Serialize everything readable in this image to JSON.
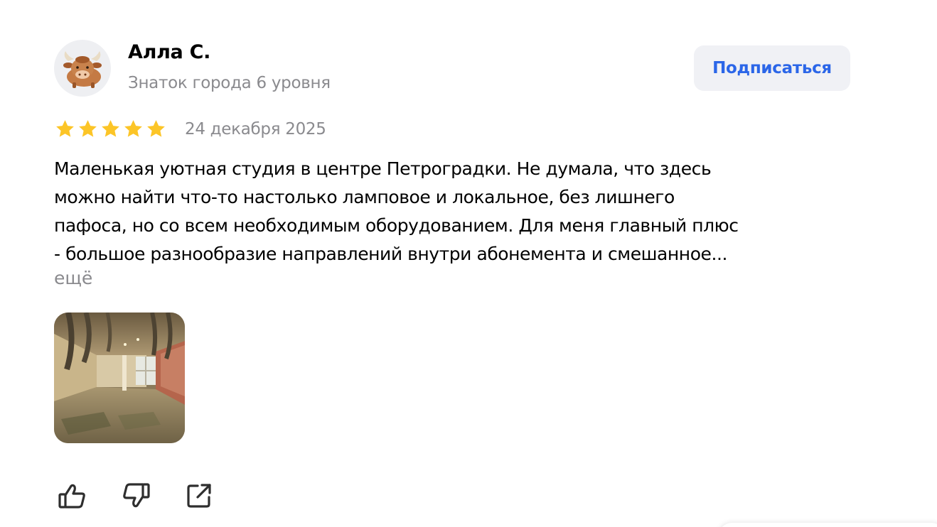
{
  "author": {
    "name": "Алла С.",
    "level": "Знаток города 6 уровня",
    "avatar_icon": "bull-emoji-icon"
  },
  "subscribe": {
    "label": "Подписаться",
    "color": "#2b66e8"
  },
  "rating": {
    "value": 5,
    "max": 5,
    "star_color": "#fcc527"
  },
  "date": "24 декабря 2025",
  "review": {
    "lines": [
      "Маленькая уютная студия в центре Петроградки. Не думала, что здесь",
      "можно найти что-то настолько ламповое и локальное, без лишнего",
      "пафоса, но со всем необходимым оборудованием. Для меня главный плюс",
      "- большое разнообразие направлений внутри абонемента и смешанное..."
    ],
    "more_label": "ещё"
  },
  "photos": [
    "studio-photo"
  ],
  "actions": [
    {
      "icon": "thumbs-up-icon"
    },
    {
      "icon": "thumbs-down-icon"
    },
    {
      "icon": "share-icon"
    }
  ]
}
